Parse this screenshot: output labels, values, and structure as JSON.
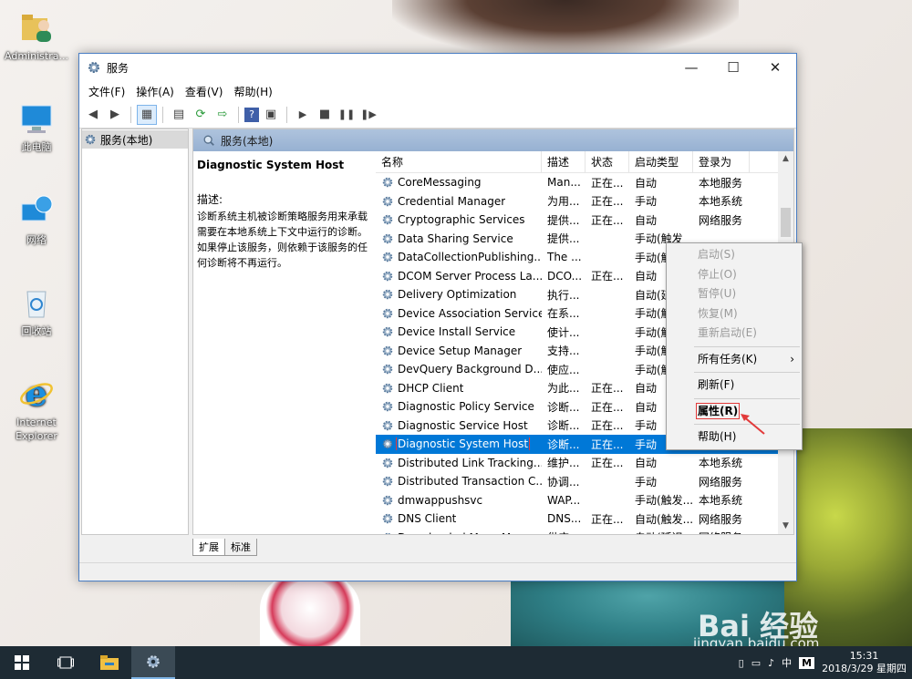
{
  "desktop": {
    "icons": [
      {
        "name": "administrator-folder",
        "label": "Administra..."
      },
      {
        "name": "this-pc",
        "label": "此电脑"
      },
      {
        "name": "network",
        "label": "网络"
      },
      {
        "name": "recycle-bin",
        "label": "回收站"
      },
      {
        "name": "internet-explorer",
        "label": "Internet Explorer"
      }
    ],
    "watermark": "Bai 经验",
    "watermark_url": "jingyan.baidu.com"
  },
  "window": {
    "title": "服务",
    "controls": {
      "minimize": "—",
      "maximize": "☐",
      "close": "✕"
    },
    "menu": [
      "文件(F)",
      "操作(A)",
      "查看(V)",
      "帮助(H)"
    ],
    "tree_root": "服务(本地)",
    "pane_title": "服务(本地)",
    "description": {
      "service_title": "Diagnostic System Host",
      "label": "描述:",
      "text": "诊断系统主机被诊断策略服务用来承载需要在本地系统上下文中运行的诊断。如果停止该服务，则依赖于该服务的任何诊断将不再运行。"
    },
    "columns": [
      "名称",
      "描述",
      "状态",
      "启动类型",
      "登录为"
    ],
    "rows": [
      {
        "name": "CoreMessaging",
        "desc": "Man...",
        "state": "正在...",
        "startup": "自动",
        "logon": "本地服务"
      },
      {
        "name": "Credential Manager",
        "desc": "为用...",
        "state": "正在...",
        "startup": "手动",
        "logon": "本地系统"
      },
      {
        "name": "Cryptographic Services",
        "desc": "提供...",
        "state": "正在...",
        "startup": "自动",
        "logon": "网络服务"
      },
      {
        "name": "Data Sharing Service",
        "desc": "提供...",
        "state": "",
        "startup": "手动(触发",
        "logon": ""
      },
      {
        "name": "DataCollectionPublishing...",
        "desc": "The ...",
        "state": "",
        "startup": "手动(触",
        "logon": ""
      },
      {
        "name": "DCOM Server Process La...",
        "desc": "DCO...",
        "state": "正在...",
        "startup": "自动",
        "logon": ""
      },
      {
        "name": "Delivery Optimization",
        "desc": "执行...",
        "state": "",
        "startup": "自动(延",
        "logon": ""
      },
      {
        "name": "Device Association Service",
        "desc": "在系...",
        "state": "",
        "startup": "手动(触",
        "logon": ""
      },
      {
        "name": "Device Install Service",
        "desc": "使计...",
        "state": "",
        "startup": "手动(触",
        "logon": ""
      },
      {
        "name": "Device Setup Manager",
        "desc": "支持...",
        "state": "",
        "startup": "手动(触",
        "logon": ""
      },
      {
        "name": "DevQuery Background D...",
        "desc": "使应...",
        "state": "",
        "startup": "手动(触",
        "logon": ""
      },
      {
        "name": "DHCP Client",
        "desc": "为此...",
        "state": "正在...",
        "startup": "自动",
        "logon": ""
      },
      {
        "name": "Diagnostic Policy Service",
        "desc": "诊断...",
        "state": "正在...",
        "startup": "自动",
        "logon": ""
      },
      {
        "name": "Diagnostic Service Host",
        "desc": "诊断...",
        "state": "正在...",
        "startup": "手动",
        "logon": ""
      },
      {
        "name": "Diagnostic System Host",
        "desc": "诊断...",
        "state": "正在...",
        "startup": "手动",
        "logon": "",
        "selected": true
      },
      {
        "name": "Distributed Link Tracking...",
        "desc": "维护...",
        "state": "正在...",
        "startup": "自动",
        "logon": "本地系统"
      },
      {
        "name": "Distributed Transaction C...",
        "desc": "协调...",
        "state": "",
        "startup": "手动",
        "logon": "网络服务"
      },
      {
        "name": "dmwappushsvc",
        "desc": "WAP...",
        "state": "",
        "startup": "手动(触发...",
        "logon": "本地系统"
      },
      {
        "name": "DNS Client",
        "desc": "DNS...",
        "state": "正在...",
        "startup": "自动(触发...",
        "logon": "网络服务"
      },
      {
        "name": "Downloaded Maps Man...",
        "desc": "供应...",
        "state": "",
        "startup": "自动(延迟...",
        "logon": "网络服务"
      }
    ],
    "tabs": [
      "扩展",
      "标准"
    ]
  },
  "context_menu": {
    "groups": [
      [
        {
          "label": "启动(S)",
          "disabled": true
        },
        {
          "label": "停止(O)",
          "disabled": true
        },
        {
          "label": "暂停(U)",
          "disabled": true
        },
        {
          "label": "恢复(M)",
          "disabled": true
        },
        {
          "label": "重新启动(E)",
          "disabled": true
        }
      ],
      [
        {
          "label": "所有任务(K)",
          "submenu": "›"
        }
      ],
      [
        {
          "label": "刷新(F)"
        }
      ],
      [
        {
          "label": "属性(R)",
          "highlighted": true
        }
      ],
      [
        {
          "label": "帮助(H)"
        }
      ]
    ]
  },
  "taskbar": {
    "ime": "中",
    "ime_mode": "M",
    "time": "15:31",
    "date": "2018/3/29 星期四"
  },
  "colors": {
    "selection": "#0078d7",
    "annotation_red": "#e23a3a",
    "taskbar": "#1e2b34"
  }
}
